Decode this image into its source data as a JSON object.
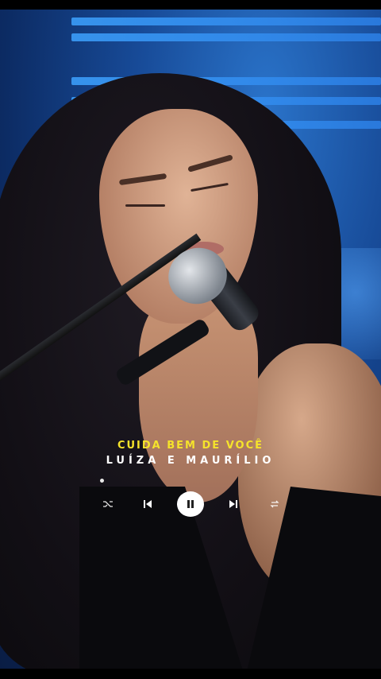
{
  "player": {
    "song_title": "CUIDA BEM DE VOCÊ",
    "artist": "LUÍZA E MAURÍLIO",
    "controls": {
      "shuffle_icon": "shuffle-icon",
      "previous_icon": "skip-previous-icon",
      "play_pause_icon": "pause-icon",
      "next_icon": "skip-next-icon",
      "repeat_icon": "repeat-icon"
    }
  },
  "colors": {
    "title": "#f5e32b",
    "artist": "#ffffff",
    "stage_blue": "#174a97"
  }
}
